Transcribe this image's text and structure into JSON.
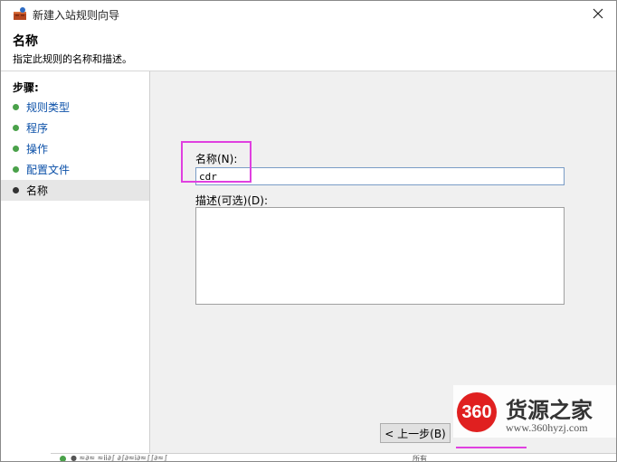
{
  "window": {
    "title": "新建入站规则向导"
  },
  "header": {
    "title": "名称",
    "description": "指定此规则的名称和描述。"
  },
  "sidebar": {
    "steps_title": "步骤:",
    "steps": [
      {
        "label": "规则类型",
        "active": false
      },
      {
        "label": "程序",
        "active": false
      },
      {
        "label": "操作",
        "active": false
      },
      {
        "label": "配置文件",
        "active": false
      },
      {
        "label": "名称",
        "active": true
      }
    ]
  },
  "form": {
    "name_label": "名称(N):",
    "name_value": "cdr",
    "description_label": "描述(可选)(D):",
    "description_value": ""
  },
  "buttons": {
    "back": "< 上一步(B)"
  },
  "watermark": {
    "logo": "360",
    "name": "货源之家",
    "url": "www.360hyzj.com"
  },
  "background": {
    "text_left": "● ≈∂≈ ≈ii∂∫ ∂∫∂≈i∂≈∫∫∂≈∫",
    "text_right": "所有"
  },
  "colors": {
    "accent_highlight": "#e040e0",
    "bullet_green": "#4aa14a",
    "link_blue": "#0b50a8"
  }
}
